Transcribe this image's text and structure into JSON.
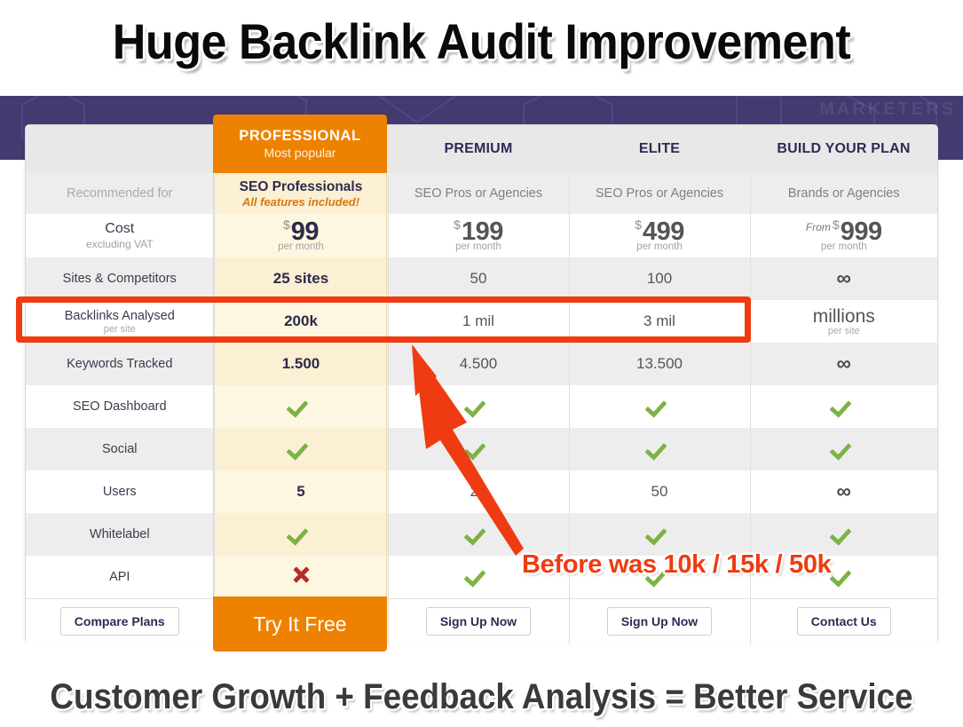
{
  "header": {
    "title": "Huge Backlink Audit Improvement",
    "banner_watermark": "MARKETERS"
  },
  "footer_caption": "Customer Growth + Feedback Analysis = Better Service",
  "annotation": {
    "note": "Before was 10k / 15k / 50k",
    "highlight_row": "Backlinks Analysed",
    "highlight_color": "#ef3b11",
    "arrow_color": "#ef3b11"
  },
  "colors": {
    "featured": "#ee8200",
    "featured_tint": "#fdf6e0",
    "banner_purple": "#433a70",
    "check_green": "#7cb342",
    "cross_red": "#b52d2d",
    "header_text": "#2f2a55"
  },
  "table": {
    "columns": [
      {
        "key": "labels",
        "name": "",
        "sub": "",
        "featured": false
      },
      {
        "key": "professional",
        "name": "PROFESSIONAL",
        "sub": "Most popular",
        "featured": true
      },
      {
        "key": "premium",
        "name": "PREMIUM",
        "sub": "",
        "featured": false
      },
      {
        "key": "elite",
        "name": "ELITE",
        "sub": "",
        "featured": false
      },
      {
        "key": "build",
        "name": "BUILD YOUR PLAN",
        "sub": "",
        "featured": false
      }
    ],
    "recommended": {
      "label": "Recommended for",
      "professional": "SEO Professionals",
      "professional_sub": "All features included!",
      "premium": "SEO Pros or Agencies",
      "elite": "SEO Pros or Agencies",
      "build": "Brands or Agencies"
    },
    "cost": {
      "label": "Cost",
      "label_sub": "excluding VAT",
      "per": "per month",
      "currency": "$",
      "from": "From",
      "professional": "99",
      "premium": "199",
      "elite": "499",
      "build": "999"
    },
    "rows": [
      {
        "label": "Sites & Competitors",
        "sub": "",
        "professional": "25 sites",
        "premium": "50",
        "elite": "100",
        "build": "∞",
        "type": "text",
        "shade": "gray"
      },
      {
        "label": "Backlinks Analysed",
        "sub": "per site",
        "professional": "200k",
        "premium": "1 mil",
        "elite": "3 mil",
        "build": "millions",
        "build_sub": "per site",
        "type": "text",
        "shade": "white",
        "highlighted": true
      },
      {
        "label": "Keywords Tracked",
        "sub": "",
        "professional": "1.500",
        "premium": "4.500",
        "elite": "13.500",
        "build": "∞",
        "type": "text",
        "shade": "gray"
      },
      {
        "label": "SEO Dashboard",
        "sub": "",
        "professional": "check",
        "premium": "check",
        "elite": "check",
        "build": "check",
        "type": "icon",
        "shade": "white"
      },
      {
        "label": "Social",
        "sub": "",
        "professional": "check",
        "premium": "check",
        "elite": "check",
        "build": "check",
        "type": "icon",
        "shade": "gray"
      },
      {
        "label": "Users",
        "sub": "",
        "professional": "5",
        "premium": "25",
        "elite": "50",
        "build": "∞",
        "type": "text",
        "shade": "white"
      },
      {
        "label": "Whitelabel",
        "sub": "",
        "professional": "check",
        "premium": "check",
        "elite": "check",
        "build": "check",
        "type": "icon",
        "shade": "gray"
      },
      {
        "label": "API",
        "sub": "",
        "professional": "cross",
        "premium": "check",
        "elite": "check",
        "build": "check",
        "type": "icon",
        "shade": "white"
      }
    ],
    "actions": {
      "labels": "Compare Plans",
      "professional": "Try It Free",
      "premium": "Sign Up Now",
      "elite": "Sign Up Now",
      "build": "Contact Us"
    }
  }
}
